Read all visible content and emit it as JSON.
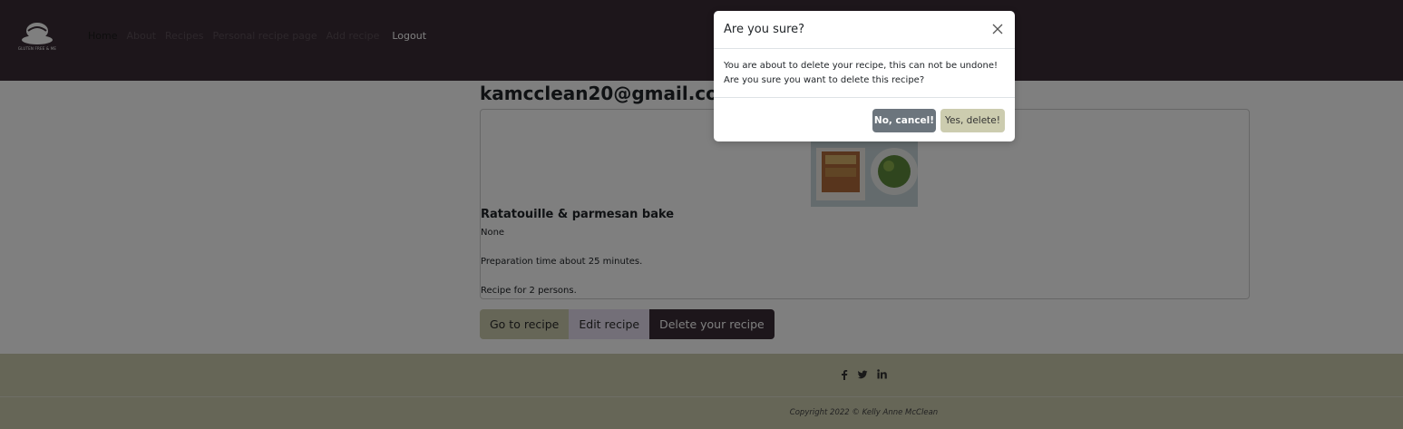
{
  "navbar": {
    "logo_text": "GLUTEN FREE & ME",
    "links": [
      "Home",
      "About",
      "Recipes",
      "Personal recipe page",
      "Add recipe"
    ],
    "logout": "Logout"
  },
  "main": {
    "heading": "kamcclean20@gmail.com's",
    "recipe": {
      "title": "Ratatouille & parmesan bake",
      "description": "None",
      "prep": "Preparation time about 25 minutes.",
      "servings": "Recipe for 2 persons."
    },
    "buttons": {
      "go": "Go to recipe",
      "edit": "Edit recipe",
      "delete": "Delete your recipe"
    }
  },
  "footer": {
    "social": [
      "facebook-icon",
      "twitter-icon",
      "linkedin-icon"
    ],
    "copyright": "Copyright 2022 © Kelly Anne McClean"
  },
  "modal": {
    "title": "Are you sure?",
    "body": "You are about to delete your recipe, this can not be undone! Are you sure you want to delete this recipe?",
    "cancel": "No, cancel!",
    "confirm": "Yes, delete!"
  },
  "colors": {
    "navbar": "#3a2d36",
    "footer": "#ccccaf",
    "edit_button": "#e6dff0",
    "cancel_button": "#6c757d"
  }
}
